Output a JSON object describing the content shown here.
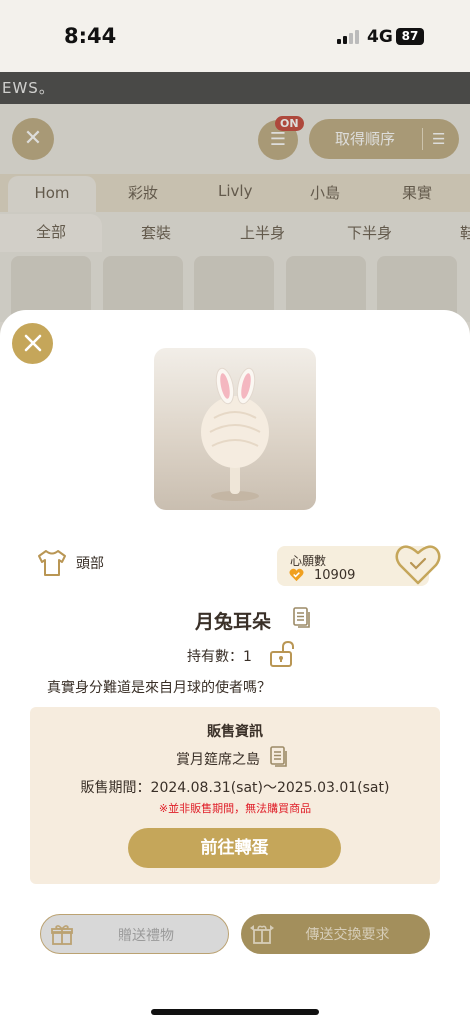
{
  "status_bar": {
    "time": "8:44",
    "network": "4G",
    "battery": "87"
  },
  "news_ticker": "EWS。",
  "background": {
    "filter_badge": "ON",
    "sort_label": "取得順序",
    "category_tabs": [
      "Hom",
      "彩妝",
      "Livly",
      "小島",
      "果實"
    ],
    "sub_tabs": [
      "全部",
      "套裝",
      "上半身",
      "下半身",
      "鞋"
    ]
  },
  "item": {
    "part_label": "頭部",
    "wish_label": "心願數",
    "wish_count": "10909",
    "name": "月兔耳朵",
    "owned": "持有數：1",
    "description": "真實身分難道是來自月球的使者嗎？"
  },
  "sale_info": {
    "title": "販售資訊",
    "source": "賞月筵席之島",
    "period": "販售期間：2024.08.31(sat)～2025.03.01(sat)",
    "warning": "※並非販售期間，無法購買商品",
    "go_button": "前往轉蛋"
  },
  "actions": {
    "gift": "贈送禮物",
    "trade": "傳送交換要求"
  },
  "colors": {
    "accent": "#c5a65a",
    "sale_panel": "#f6ecde",
    "warning": "#e0202a",
    "heart": "#f0a020"
  },
  "icons": {
    "close": "close-icon",
    "part": "shirt-icon",
    "copy": "copy-icon",
    "lock": "unlocked-lock-icon",
    "wish": "heart-check-icon",
    "gift": "gift-icon",
    "trade": "trade-icon"
  }
}
